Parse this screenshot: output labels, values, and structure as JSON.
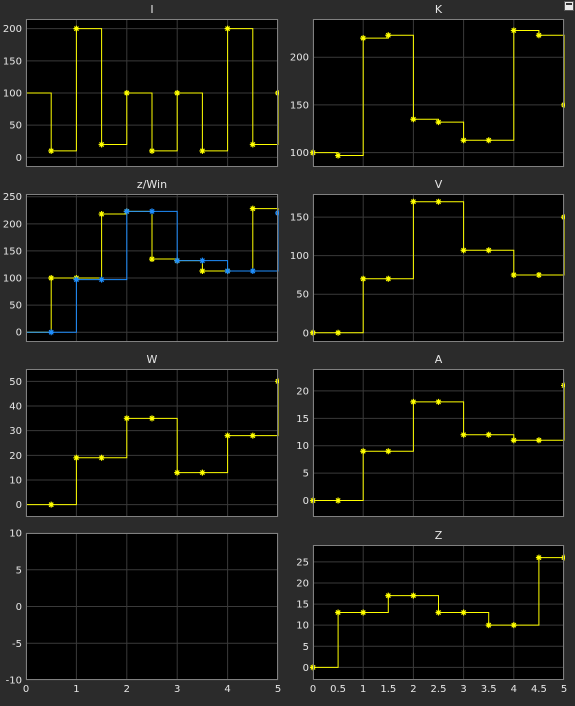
{
  "colors": {
    "background": "#2b2b2b",
    "axes_background": "#000000",
    "grid": "#3a3a3a",
    "text": "#e6e6e6",
    "yellow": "#ffff00",
    "blue": "#1f8fff"
  },
  "toolbar": {
    "undock_icon": "undock-icon"
  },
  "chart_data": [
    {
      "id": "I",
      "title": "I",
      "type": "line",
      "step": true,
      "xlim": [
        0,
        5
      ],
      "ylim": [
        -15,
        215
      ],
      "yticks": [
        0,
        50,
        100,
        150,
        200
      ],
      "xtick_labels": false,
      "grid": true,
      "series": [
        {
          "color": "#ffff00",
          "x": [
            0,
            0.5,
            1,
            1.5,
            2,
            2.5,
            3,
            3.5,
            4,
            4.5,
            5
          ],
          "y": [
            100,
            10,
            200,
            20,
            100,
            10,
            100,
            10,
            200,
            20,
            100
          ],
          "markers": [
            0.5,
            1,
            1.5,
            2,
            2.5,
            3,
            3.5,
            4,
            4.5,
            5
          ]
        }
      ]
    },
    {
      "id": "K",
      "title": "K",
      "type": "line",
      "step": true,
      "xlim": [
        0,
        5
      ],
      "ylim": [
        85,
        240
      ],
      "yticks": [
        100,
        150,
        200
      ],
      "xtick_labels": false,
      "grid": true,
      "series": [
        {
          "color": "#ffff00",
          "x": [
            0,
            0.5,
            1,
            1.5,
            2,
            2.5,
            3,
            3.5,
            4,
            4.5,
            5
          ],
          "y": [
            100,
            97,
            220,
            223,
            135,
            132,
            113,
            113,
            228,
            223,
            150
          ],
          "markers": [
            0,
            0.5,
            1,
            1.5,
            2,
            2.5,
            3,
            3.5,
            4,
            4.5,
            5
          ]
        }
      ]
    },
    {
      "id": "zwin",
      "title": "z/Win",
      "type": "line",
      "step": true,
      "xlim": [
        0,
        5
      ],
      "ylim": [
        -18,
        255
      ],
      "yticks": [
        0,
        50,
        100,
        150,
        200,
        250
      ],
      "xtick_labels": false,
      "grid": true,
      "series": [
        {
          "color": "#ffff00",
          "x": [
            0,
            0.5,
            1,
            1.5,
            2,
            2.5,
            3,
            3.5,
            4,
            4.5,
            5
          ],
          "y": [
            0,
            100,
            100,
            218,
            223,
            135,
            132,
            113,
            113,
            228,
            223
          ],
          "markers": [
            0.5,
            1,
            1.5,
            2,
            2.5,
            3,
            3.5,
            4,
            4.5
          ]
        },
        {
          "color": "#1f8fff",
          "x": [
            0,
            0.5,
            1,
            1.5,
            2,
            2.5,
            3,
            3.5,
            4,
            4.5,
            5
          ],
          "y": [
            0,
            0,
            97,
            97,
            223,
            223,
            132,
            132,
            113,
            113,
            220
          ],
          "markers": [
            0.5,
            1,
            1.5,
            2,
            2.5,
            3,
            3.5,
            4,
            4.5,
            5
          ]
        }
      ]
    },
    {
      "id": "V",
      "title": "V",
      "type": "line",
      "step": true,
      "xlim": [
        0,
        5
      ],
      "ylim": [
        -12,
        180
      ],
      "yticks": [
        0,
        50,
        100,
        150
      ],
      "xtick_labels": false,
      "grid": true,
      "series": [
        {
          "color": "#ffff00",
          "x": [
            0,
            0.5,
            1,
            1.5,
            2,
            2.5,
            3,
            3.5,
            4,
            4.5,
            5
          ],
          "y": [
            0,
            0,
            70,
            70,
            170,
            170,
            107,
            107,
            75,
            75,
            150
          ],
          "markers": [
            0,
            0.5,
            1,
            1.5,
            2,
            2.5,
            3,
            3.5,
            4,
            4.5,
            5
          ]
        }
      ]
    },
    {
      "id": "W",
      "title": "W",
      "type": "line",
      "step": true,
      "xlim": [
        0,
        5
      ],
      "ylim": [
        -5,
        55
      ],
      "yticks": [
        0,
        10,
        20,
        30,
        40,
        50
      ],
      "xtick_labels": false,
      "grid": true,
      "series": [
        {
          "color": "#ffff00",
          "x": [
            0,
            0.5,
            1,
            1.5,
            2,
            2.5,
            3,
            3.5,
            4,
            4.5,
            5
          ],
          "y": [
            0,
            0,
            19,
            19,
            35,
            35,
            13,
            13,
            28,
            28,
            50
          ],
          "markers": [
            0.5,
            1,
            1.5,
            2,
            2.5,
            3,
            3.5,
            4,
            4.5,
            5
          ]
        }
      ]
    },
    {
      "id": "A",
      "title": "A",
      "type": "line",
      "step": true,
      "xlim": [
        0,
        5
      ],
      "ylim": [
        -3,
        24
      ],
      "yticks": [
        0,
        5,
        10,
        15,
        20
      ],
      "xtick_labels": false,
      "grid": true,
      "series": [
        {
          "color": "#ffff00",
          "x": [
            0,
            0.5,
            1,
            1.5,
            2,
            2.5,
            3,
            3.5,
            4,
            4.5,
            5
          ],
          "y": [
            0,
            0,
            9,
            9,
            18,
            18,
            12,
            12,
            11,
            11,
            21
          ],
          "markers": [
            0,
            0.5,
            1,
            1.5,
            2,
            2.5,
            3,
            3.5,
            4,
            4.5,
            5
          ]
        }
      ]
    },
    {
      "id": "empty",
      "title": "",
      "type": "line",
      "step": true,
      "xlim": [
        0,
        5
      ],
      "ylim": [
        -10,
        10
      ],
      "yticks": [
        -10,
        -5,
        0,
        5,
        10
      ],
      "xticks": [
        0,
        1,
        2,
        3,
        4,
        5
      ],
      "xtick_labels": true,
      "grid": true,
      "series": []
    },
    {
      "id": "Z",
      "title": "Z",
      "type": "line",
      "step": true,
      "xlim": [
        0,
        5
      ],
      "ylim": [
        -3,
        29
      ],
      "yticks": [
        0,
        5,
        10,
        15,
        20,
        25
      ],
      "xticks": [
        0,
        0.5,
        1,
        1.5,
        2,
        2.5,
        3,
        3.5,
        4,
        4.5,
        5
      ],
      "xtick_labels": true,
      "grid": true,
      "series": [
        {
          "color": "#ffff00",
          "x": [
            0,
            0.5,
            1,
            1.5,
            2,
            2.5,
            3,
            3.5,
            4,
            4.5,
            5
          ],
          "y": [
            0,
            13,
            13,
            17,
            17,
            13,
            13,
            10,
            10,
            26,
            26
          ],
          "markers": [
            0,
            0.5,
            1,
            1.5,
            2,
            2.5,
            3,
            3.5,
            4,
            4.5,
            5
          ]
        }
      ]
    }
  ]
}
